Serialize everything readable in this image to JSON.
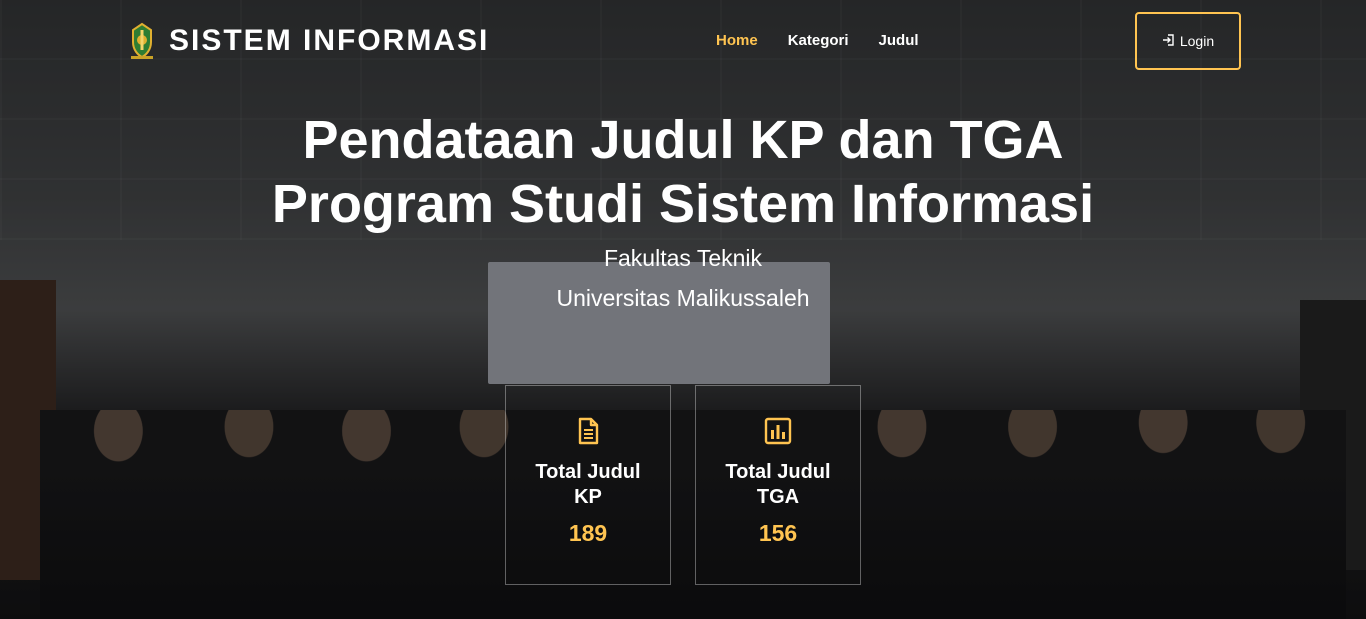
{
  "brand": {
    "title": "SISTEM INFORMASI",
    "logo_icon": "university-crest-icon"
  },
  "nav": {
    "items": [
      {
        "label": "Home",
        "active": true
      },
      {
        "label": "Kategori",
        "active": false
      },
      {
        "label": "Judul",
        "active": false
      }
    ]
  },
  "login": {
    "label": "Login",
    "icon": "login-icon"
  },
  "hero": {
    "title_line1": "Pendataan Judul KP dan TGA",
    "title_line2": "Program Studi Sistem Informasi",
    "faculty": "Fakultas Teknik",
    "university": "Universitas Malikussaleh"
  },
  "stats": {
    "kp": {
      "label": "Total Judul KP",
      "value": "189",
      "icon": "document-icon"
    },
    "tga": {
      "label": "Total Judul TGA",
      "value": "156",
      "icon": "bar-chart-icon"
    }
  },
  "colors": {
    "accent": "#ffc451",
    "text": "#ffffff",
    "overlay": "rgba(0,0,0,0.38)"
  }
}
